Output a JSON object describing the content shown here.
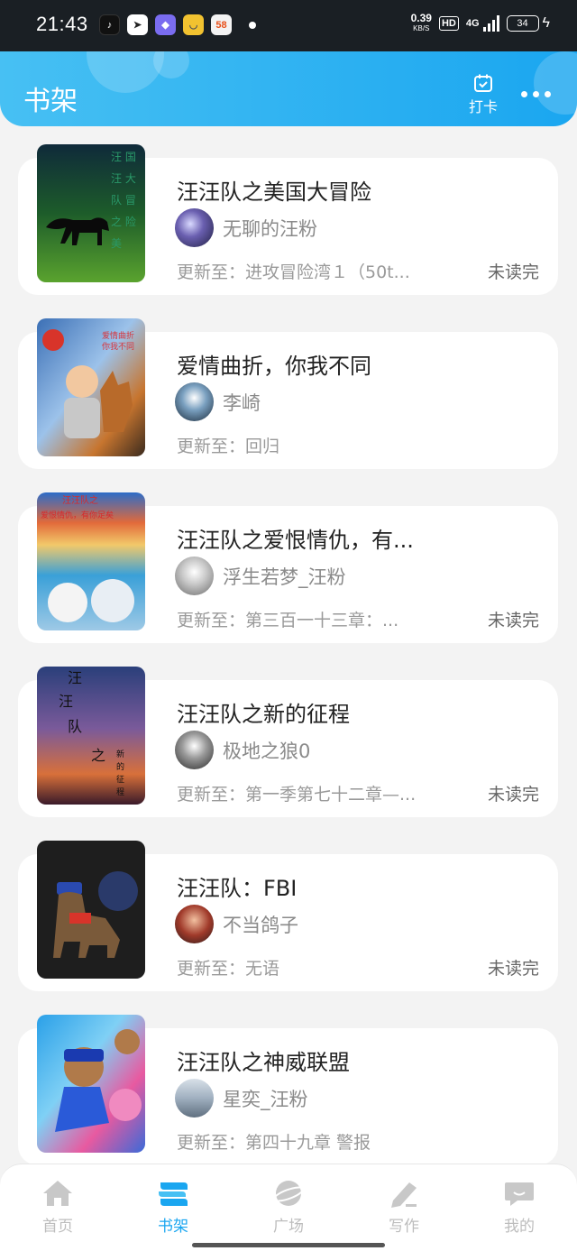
{
  "status": {
    "time": "21:43",
    "net_speed": "0.39",
    "net_unit": "KB/S",
    "hd": "HD",
    "network": "4G",
    "battery": "34",
    "app_icons": [
      {
        "name": "douyin-icon",
        "glyph": "♪",
        "color": "#111111"
      },
      {
        "name": "app-arrow-icon",
        "glyph": "➤",
        "color": "#2a2a2a"
      },
      {
        "name": "app-purple-icon",
        "glyph": "◆",
        "color": "#7a6cf0"
      },
      {
        "name": "app-yellow-icon",
        "glyph": "◡",
        "color": "#f2c230"
      },
      {
        "name": "app-58-icon",
        "glyph": "58",
        "color": "#f3f3f3"
      }
    ]
  },
  "header": {
    "title": "书架",
    "checkin_label": "打卡"
  },
  "books": [
    {
      "title": "汪汪队之美国大冒险",
      "author": "无聊的汪粉",
      "update": "更新至：进攻冒险湾１（50t...",
      "unread": "未读完",
      "cover_bg": "linear-gradient(180deg,#0f2a3a 0%,#1d5c2a 45%,#4f9a2b 100%)",
      "cover_text": "汪 国 汪 大 队 冒 之 险 美",
      "avatar_bg": "radial-gradient(circle at 40% 40%,#d9d9ff 0%,#6a5fb0 40%,#202040 100%)"
    },
    {
      "title": "爱情曲折，你我不同",
      "author": "李崎",
      "update": "更新至：回归",
      "unread": "",
      "cover_bg": "linear-gradient(160deg,#3b6fb5 0%,#8fb9e8 40%,#c7752f 75%,#3a2a1e 100%)",
      "cover_text": "爱情曲折 你我不同",
      "avatar_bg": "radial-gradient(circle at 50% 40%,#ffffff 0%,#7aa0c0 40%,#1a2a3a 100%)"
    },
    {
      "title": "汪汪队之爱恨情仇，有...",
      "author": "浮生若梦_汪粉",
      "update": "更新至：第三百一十三章：...",
      "unread": "未读完",
      "cover_bg": "linear-gradient(180deg,#2c6cc8 0%,#e26a3a 25%,#f2c96a 40%,#3aa0d8 60%,#9ec9e6 100%)",
      "cover_text": "汪汪队之 爱恨情仇，有你足矣",
      "avatar_bg": "radial-gradient(circle at 50% 40%,#ffffff 0%,#c9c9c9 40%,#6a6a6a 100%)"
    },
    {
      "title": "汪汪队之新的征程",
      "author": "极地之狼0",
      "update": "更新至：第一季第七十二章—...",
      "unread": "未读完",
      "cover_bg": "linear-gradient(180deg,#2a3f7a 0%,#7a5a9a 40%,#d8703a 75%,#3a1a2a 100%)",
      "cover_text": "汪 汪 队 之 新的征程",
      "avatar_bg": "radial-gradient(circle at 50% 40%,#ffffff 0%,#9a9a9a 40%,#2a2a2a 100%)"
    },
    {
      "title": "汪汪队：FBI",
      "author": "不当鸽子",
      "update": "更新至：无语",
      "unread": "未读完",
      "cover_bg": "radial-gradient(circle at 50% 60%,#5a4a3a 0%,#1e1e1e 60%,#141414 100%)",
      "cover_text": "",
      "avatar_bg": "radial-gradient(circle at 50% 40%,#f2c0a0 0%,#a03a2a 50%,#2a1a1a 100%)"
    },
    {
      "title": "汪汪队之神威联盟",
      "author": "星奕_汪粉",
      "update": "更新至：第四十九章 警报",
      "unread": "",
      "cover_bg": "linear-gradient(150deg,#2aa0e8 0%,#7fd0f5 35%,#e85aa0 65%,#3a6ad8 100%)",
      "cover_text": "",
      "avatar_bg": "linear-gradient(180deg,#d8e0e8 0%,#a0b0c0 50%,#607080 100%)"
    }
  ],
  "tabs": [
    {
      "label": "首页",
      "icon": "home-icon"
    },
    {
      "label": "书架",
      "icon": "bookshelf-icon"
    },
    {
      "label": "广场",
      "icon": "planet-icon"
    },
    {
      "label": "写作",
      "icon": "pencil-icon"
    },
    {
      "label": "我的",
      "icon": "chat-bubble-icon"
    }
  ],
  "colors": {
    "accent": "#1aa6f0",
    "inactive": "#bdbdbd"
  }
}
